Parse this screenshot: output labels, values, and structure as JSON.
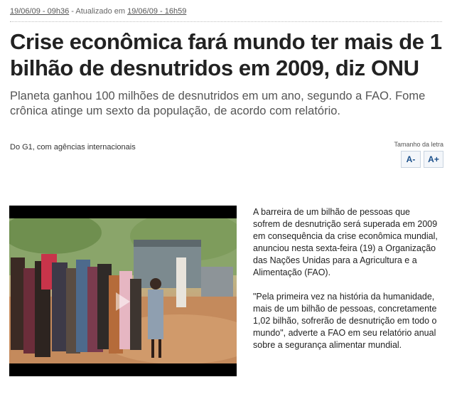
{
  "meta": {
    "published": "19/06/09 - 09h36",
    "separator": " - ",
    "updated_label": "Atualizado em ",
    "updated": "19/06/09 - 16h59"
  },
  "headline": "Crise econômica fará mundo ter mais de 1 bilhão de desnutridos em 2009, diz ONU",
  "subheadline": "Planeta ganhou 100 milhões de desnutridos em um ano, segundo a FAO. Fome crônica atinge um sexto da população, de acordo com relatório.",
  "byline": "Do G1, com agências internacionais",
  "font_size": {
    "label": "Tamanho da letra",
    "decrease": "A-",
    "increase": "A+"
  },
  "video": {
    "play_icon": "play-icon"
  },
  "article": {
    "paragraphs": [
      "A barreira de um bilhão de pessoas que sofrem de desnutrição será superada em 2009 em consequência da crise econômica mundial, anunciou nesta sexta-feira (19) a Organização das Nações Unidas para a Agricultura e a Alimentação (FAO).",
      "\"Pela primeira vez na história da humanidade, mais de um bilhão de pessoas, concretamente 1,02 bilhão, sofrerão de desnutrição em todo o mundo\", adverte a FAO em seu relatório anual sobre a segurança alimentar mundial."
    ]
  }
}
